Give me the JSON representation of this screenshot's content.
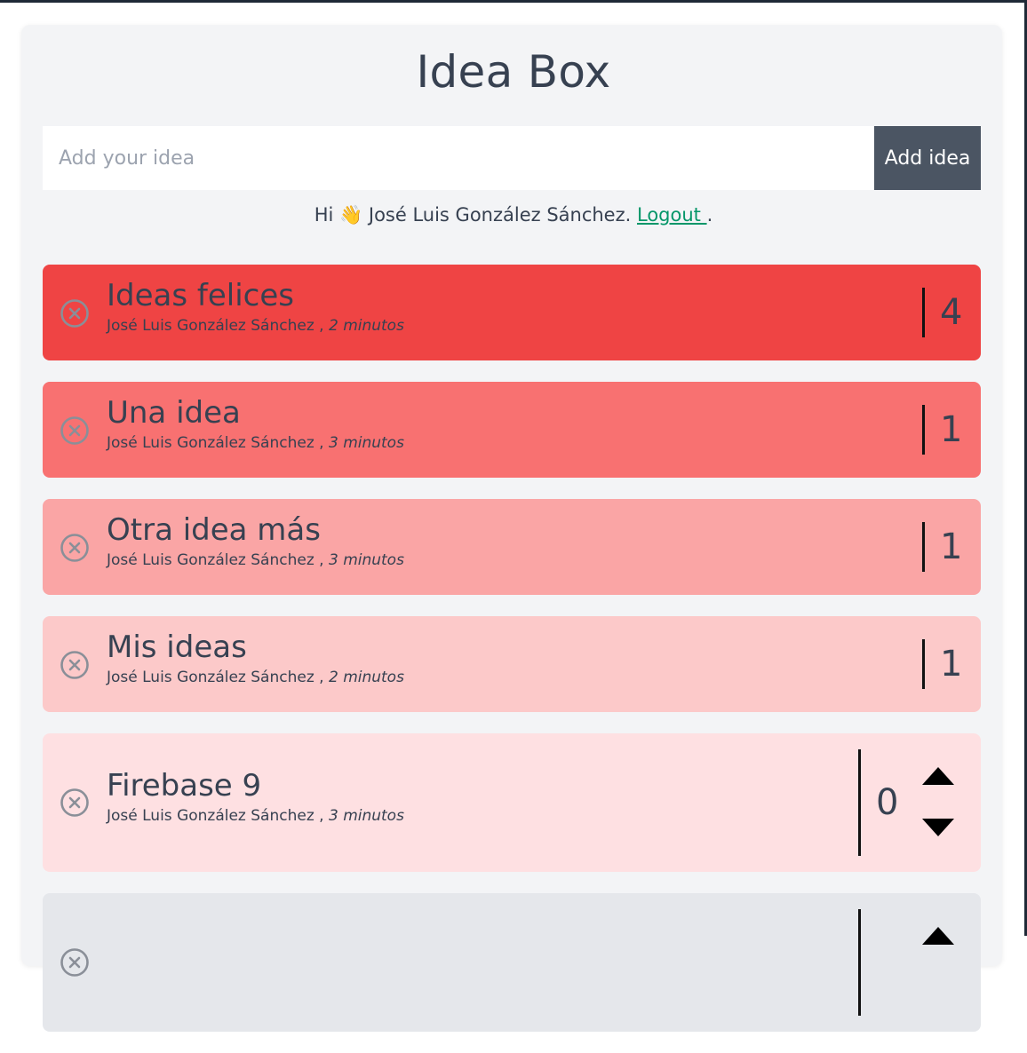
{
  "app": {
    "title": "Idea Box"
  },
  "form": {
    "placeholder": "Add your idea",
    "value": "",
    "button_label": "Add idea"
  },
  "greeting": {
    "prefix": "Hi 👋 José Luis González Sánchez. ",
    "logout_label": "Logout ",
    "suffix": "."
  },
  "ideas": [
    {
      "title": "Ideas felices",
      "author": "José Luis González Sánchez",
      "separator": ",",
      "time": "2 minutos",
      "votes": "4",
      "color": "#ef4444",
      "can_vote": false
    },
    {
      "title": "Una idea",
      "author": "José Luis González Sánchez",
      "separator": ",",
      "time": "3 minutos",
      "votes": "1",
      "color": "#f87171",
      "can_vote": false
    },
    {
      "title": "Otra idea más",
      "author": "José Luis González Sánchez",
      "separator": ",",
      "time": "3 minutos",
      "votes": "1",
      "color": "#faa5a5",
      "can_vote": false
    },
    {
      "title": "Mis ideas",
      "author": "José Luis González Sánchez",
      "separator": ",",
      "time": "2 minutos",
      "votes": "1",
      "color": "#fcc9c9",
      "can_vote": false
    },
    {
      "title": "Firebase 9",
      "author": "José Luis González Sánchez",
      "separator": ",",
      "time": "3 minutos",
      "votes": "0",
      "color": "#fee0e2",
      "can_vote": true
    },
    {
      "title": "",
      "author": "",
      "separator": "",
      "time": "",
      "votes": "",
      "color": "#e5e7eb",
      "can_vote": true
    }
  ],
  "colors": {
    "panel_bg": "#f3f4f6",
    "button_bg": "#4b5563",
    "link": "#059669",
    "text": "#374151"
  },
  "icons": {
    "delete": "x-circle-icon",
    "upvote": "triangle-up-icon",
    "downvote": "triangle-down-icon"
  }
}
